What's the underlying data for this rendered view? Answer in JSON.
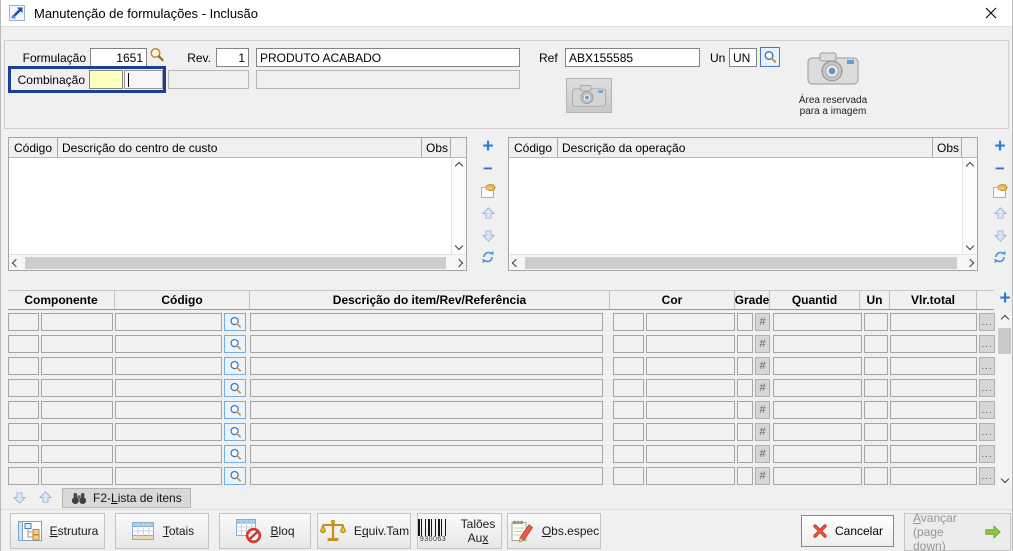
{
  "window": {
    "title": "Manutenção de formulações - Inclusão"
  },
  "form": {
    "formulacao": {
      "label": "Formulação",
      "value": "1651"
    },
    "rev": {
      "label": "Rev.",
      "value": "1"
    },
    "descricao": {
      "value": "PRODUTO ACABADO"
    },
    "ref": {
      "label": "Ref",
      "value": "ABX155585"
    },
    "un": {
      "label": "Un",
      "value": "UN"
    },
    "combinacao": {
      "label": "Combinação",
      "code_value": "",
      "desc_value": ""
    },
    "image_area": {
      "line1": "Área reservada",
      "line2": "para a imagem"
    }
  },
  "cost_center_panel": {
    "col_codigo": "Código",
    "col_descricao": "Descrição do centro de custo",
    "col_obs": "Obs"
  },
  "operation_panel": {
    "col_codigo": "Código",
    "col_descricao": "Descrição da operação",
    "col_obs": "Obs"
  },
  "items_grid": {
    "headers": [
      "Componente",
      "Código",
      "Descrição do item/Rev/Referência",
      "Cor",
      "Grade",
      "Quantid",
      "Un",
      "Vlr.total"
    ],
    "row_count": 8,
    "grade_glyph": "#",
    "more_glyph": "..."
  },
  "footer": {
    "f2_button": {
      "pre": "F2-",
      "key": "L",
      "rest": "ista de itens"
    }
  },
  "toolbar": {
    "estrutura": {
      "pre": "",
      "key": "E",
      "rest": "strutura"
    },
    "totais": {
      "pre": "",
      "key": "T",
      "rest": "otais"
    },
    "bloq": {
      "pre": "",
      "key": "B",
      "rest": "loq"
    },
    "equiv_tam": {
      "pre": "E",
      "key": "q",
      "rest": "uiv.Tam"
    },
    "taloes_aux": {
      "pre": "Talões Au",
      "key": "x",
      "rest": ""
    },
    "taloes_barcode": "930063",
    "obs_espec": {
      "pre": "",
      "key": "O",
      "rest": "bs.espec"
    },
    "cancelar": {
      "label": "Cancelar"
    },
    "avancar": {
      "key": "A",
      "rest": "vançar",
      "line2": "(page down)"
    }
  },
  "colors": {
    "focus_border": "#1e3d96",
    "highlight_yellow": "#ffffc0",
    "accent_blue": "#2e7bd6",
    "cancel_red": "#d03825",
    "next_green": "#8dc63f"
  }
}
